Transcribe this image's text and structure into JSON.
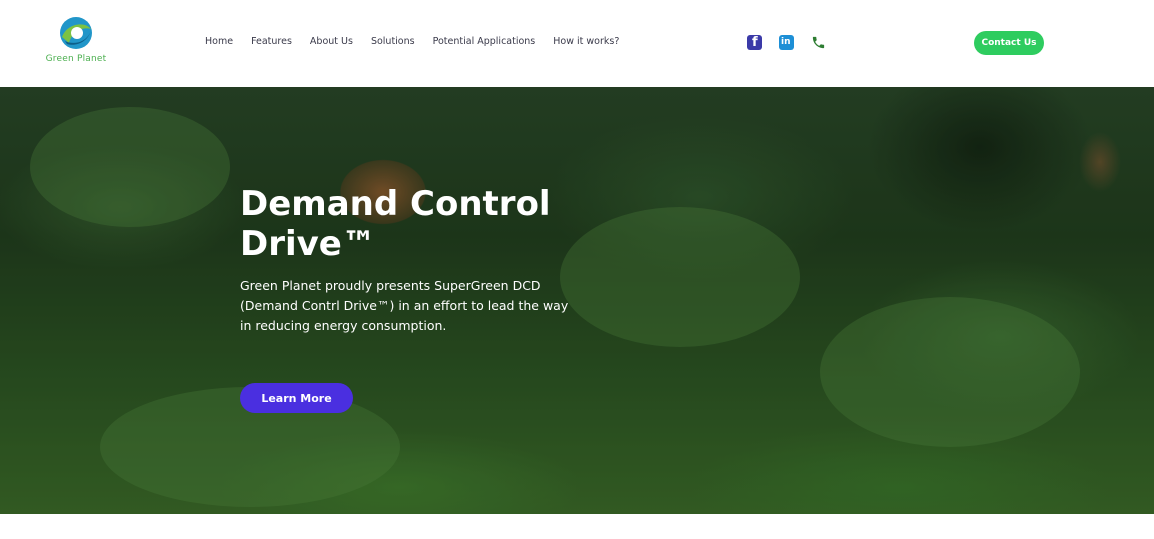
{
  "header": {
    "logo_text": "Green Planet",
    "nav": [
      "Home",
      "Features",
      "About Us",
      "Solutions",
      "Potential Applications",
      "How it works?"
    ],
    "socials": [
      {
        "icon": "facebook-icon",
        "glyph": "f",
        "color": "#3b3aa8"
      },
      {
        "icon": "linkedin-icon",
        "glyph": "in",
        "color": "#1d8fd6"
      },
      {
        "icon": "phone-icon",
        "color": "#2e7d32"
      }
    ],
    "contact_label": "Contact Us",
    "contact_color": "#2ecc5f"
  },
  "hero": {
    "title": "Demand Control Drive™",
    "text": "Green Planet proudly presents SuperGreen DCD (Demand Contrl Drive™) in an effort to lead the way in reducing energy consumption.",
    "button_label": "Learn More",
    "button_color": "#4a2fe0"
  }
}
